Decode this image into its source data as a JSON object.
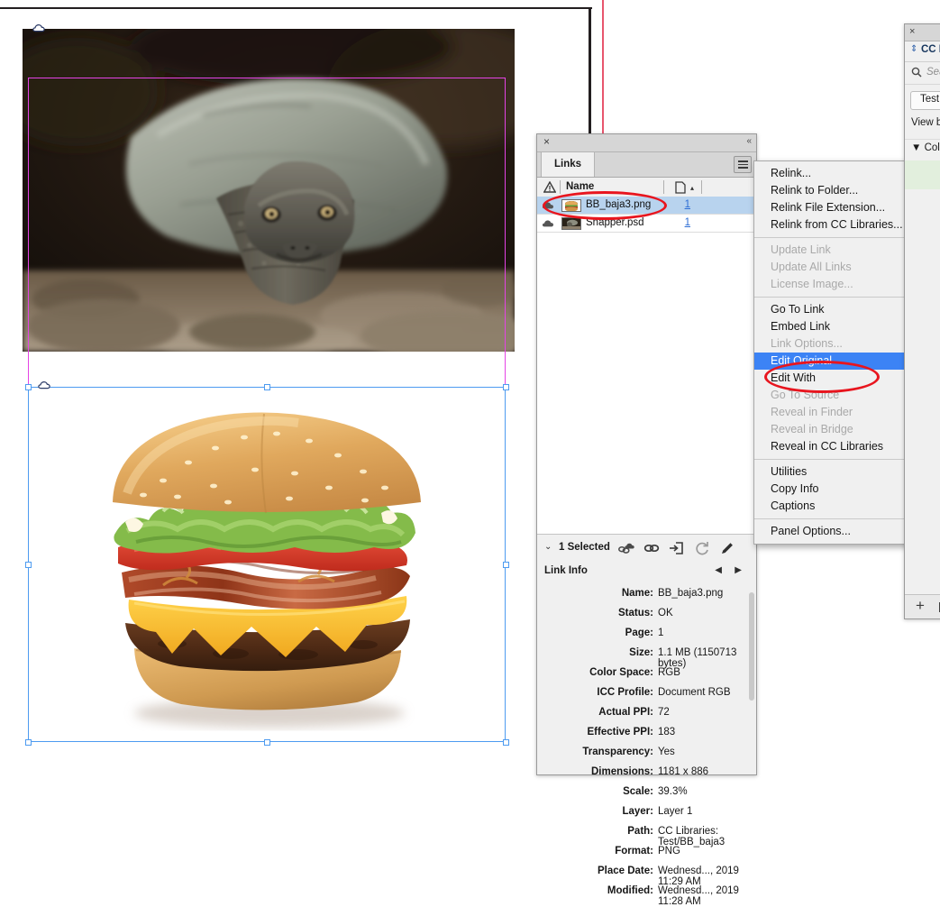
{
  "document": {
    "turtle_frame": {
      "label": "snapping-turtle-image",
      "cloud_badge": "cc-libraries-link-badge"
    },
    "burger_frame": {
      "label": "bacon-burger-image",
      "cloud_badge": "cc-libraries-link-badge"
    }
  },
  "links_panel": {
    "title": "Links",
    "close_glyph": "×",
    "collapse_glyph": "«",
    "columns": {
      "warning": "⚠",
      "name": "Name",
      "page": "⎙",
      "sort_glyph": "▴"
    },
    "rows": [
      {
        "name": "BB_baja3.png",
        "page": "1",
        "selected": true,
        "cloud": true
      },
      {
        "name": "Snapper.psd",
        "page": "1",
        "selected": false,
        "cloud": true
      }
    ],
    "footer": {
      "chevron": "⌄",
      "selection": "1 Selected",
      "icons": [
        "relink-from-cc-libraries-icon",
        "relink-icon",
        "goto-link-icon",
        "update-link-icon",
        "edit-original-icon"
      ]
    }
  },
  "link_info": {
    "header": "Link Info",
    "prev_glyph": "◀",
    "next_glyph": "▶",
    "fields": [
      {
        "key": "Name:",
        "value": "BB_baja3.png"
      },
      {
        "key": "Status:",
        "value": "OK"
      },
      {
        "key": "Page:",
        "value": "1"
      },
      {
        "key": "Size:",
        "value": "1.1 MB (1150713 bytes)"
      },
      {
        "key": "Color Space:",
        "value": "RGB"
      },
      {
        "key": "ICC Profile:",
        "value": "Document RGB"
      },
      {
        "key": "Actual PPI:",
        "value": "72"
      },
      {
        "key": "Effective PPI:",
        "value": "183"
      },
      {
        "key": "Transparency:",
        "value": "Yes"
      },
      {
        "key": "Dimensions:",
        "value": "1181 x 886"
      },
      {
        "key": "Scale:",
        "value": "39.3%"
      },
      {
        "key": "Layer:",
        "value": "Layer 1"
      },
      {
        "key": "Path:",
        "value": "CC Libraries: Test/BB_baja3"
      },
      {
        "key": "Format:",
        "value": "PNG"
      },
      {
        "key": "Place Date:",
        "value": "Wednesd..., 2019 11:29 AM"
      },
      {
        "key": "Modified:",
        "value": "Wednesd..., 2019 11:28 AM"
      }
    ]
  },
  "context_menu": {
    "groups": [
      [
        {
          "label": "Relink...",
          "state": "normal"
        },
        {
          "label": "Relink to Folder...",
          "state": "normal"
        },
        {
          "label": "Relink File Extension...",
          "state": "normal"
        },
        {
          "label": "Relink from CC Libraries...",
          "state": "normal"
        }
      ],
      [
        {
          "label": "Update Link",
          "state": "disabled"
        },
        {
          "label": "Update All Links",
          "state": "disabled"
        },
        {
          "label": "License Image...",
          "state": "disabled"
        }
      ],
      [
        {
          "label": "Go To Link",
          "state": "normal"
        },
        {
          "label": "Embed Link",
          "state": "normal"
        },
        {
          "label": "Link Options...",
          "state": "disabled"
        },
        {
          "label": "Edit Original",
          "state": "highlighted"
        },
        {
          "label": "Edit With",
          "state": "normal",
          "submenu": true
        },
        {
          "label": "Go To Source",
          "state": "disabled"
        },
        {
          "label": "Reveal in Finder",
          "state": "disabled"
        },
        {
          "label": "Reveal in Bridge",
          "state": "disabled"
        },
        {
          "label": "Reveal in CC Libraries",
          "state": "normal"
        }
      ],
      [
        {
          "label": "Utilities",
          "state": "normal",
          "submenu": true
        },
        {
          "label": "Copy Info",
          "state": "normal",
          "submenu": true
        },
        {
          "label": "Captions",
          "state": "normal",
          "submenu": true
        }
      ],
      [
        {
          "label": "Panel Options...",
          "state": "normal"
        }
      ]
    ],
    "submenu_glyph": "▶",
    "highlight_color": "#3c83f5"
  },
  "cc_libraries_panel": {
    "close_glyph": "×",
    "grip_glyph": "⇕",
    "title": "CC L",
    "search_icon": "search-icon",
    "search_placeholder": "Sea",
    "library_name": "Test",
    "view_by": "View b",
    "section": "Colo",
    "section_chevron": "▼",
    "footer_add": "+",
    "footer_delete": "trash-icon"
  },
  "annotations": {
    "color": "#e8151e",
    "items": [
      "links-row-BB_baja3-highlight",
      "menu-edit-original-highlight"
    ]
  }
}
